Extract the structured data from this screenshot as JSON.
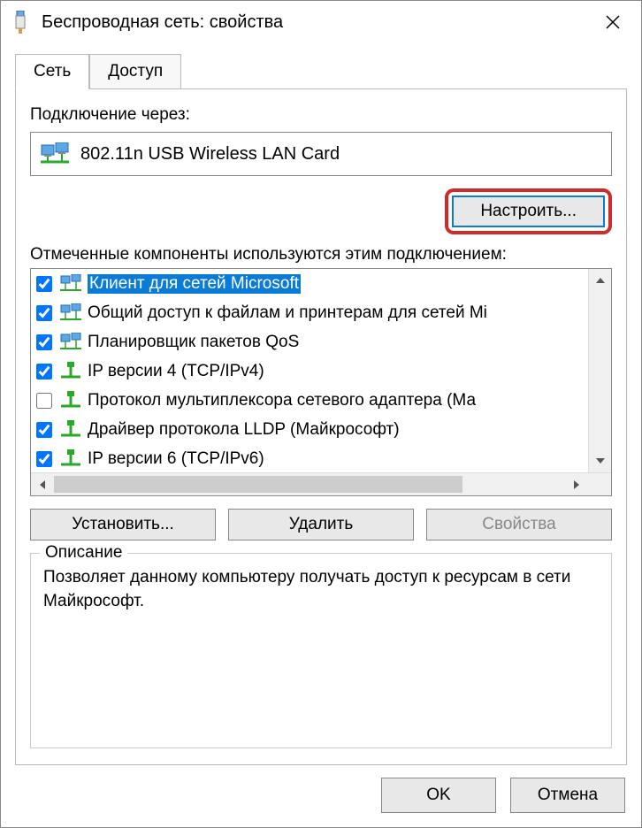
{
  "title": "Беспроводная сеть: свойства",
  "tabs": {
    "network": "Сеть",
    "access": "Доступ"
  },
  "connect_via_label": "Подключение через:",
  "adapter_name": "802.11n USB Wireless LAN Card",
  "configure_button": "Настроить...",
  "components_label": "Отмеченные компоненты используются этим подключением:",
  "components": [
    {
      "checked": true,
      "icon": "client",
      "label": "Клиент для сетей Microsoft",
      "selected": true
    },
    {
      "checked": true,
      "icon": "service",
      "label": "Общий доступ к файлам и принтерам для сетей Mi"
    },
    {
      "checked": true,
      "icon": "service",
      "label": "Планировщик пакетов QoS"
    },
    {
      "checked": true,
      "icon": "protocol",
      "label": "IP версии 4 (TCP/IPv4)"
    },
    {
      "checked": false,
      "icon": "protocol",
      "label": "Протокол мультиплексора сетевого адаптера (Ма"
    },
    {
      "checked": true,
      "icon": "protocol",
      "label": "Драйвер протокола LLDP (Майкрософт)"
    },
    {
      "checked": true,
      "icon": "protocol",
      "label": "IP версии 6 (TCP/IPv6)"
    }
  ],
  "install_button": "Установить...",
  "uninstall_button": "Удалить",
  "properties_button": "Свойства",
  "description_group": "Описание",
  "description_text": "Позволяет данному компьютеру получать доступ к ресурсам в сети Майкрософт.",
  "ok_button": "OK",
  "cancel_button": "Отмена"
}
